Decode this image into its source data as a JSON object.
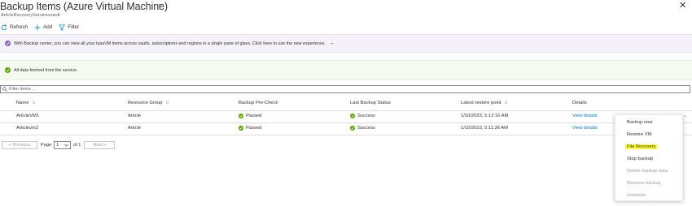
{
  "header": {
    "title": "Backup Items (Azure Virtual Machine)",
    "more": "···",
    "subtitle": "ArticleRecoveryServicesvault",
    "close": "✕"
  },
  "toolbar": {
    "refresh_label": "Refresh",
    "add_label": "Add",
    "filter_label": "Filter"
  },
  "banners": {
    "info_text": "With Backup center, you can view all your IaasVM items across vaults, subscriptions and regions in a single pane of glass. Click here to use the new experience.",
    "info_arrow": "→",
    "success_text": "All data fetched from the service."
  },
  "filter": {
    "placeholder": "Filter items ..."
  },
  "table": {
    "columns": [
      "Name",
      "Resource Group",
      "Backup Pre-Check",
      "Last Backup Status",
      "Latest restore point",
      "Details"
    ],
    "sort_glyph": "↑↓",
    "rows": [
      {
        "name": "ArticleVM1",
        "resource_group": "Article",
        "precheck": "Passed",
        "status": "Success",
        "restore_point": "1/10/2023, 5:12:16 AM",
        "details": "View details"
      },
      {
        "name": "Articlevm2",
        "resource_group": "Article",
        "precheck": "Passed",
        "status": "Success",
        "restore_point": "1/10/2023, 5:11:36 AM",
        "details": "View details"
      }
    ]
  },
  "pager": {
    "prev": "« Previous",
    "page_label": "Page",
    "page_value": "1",
    "of_label": "of 1",
    "next": "Next »"
  },
  "context_menu": {
    "items": [
      {
        "label": "Backup now",
        "enabled": true
      },
      {
        "label": "Restore VM",
        "enabled": true
      },
      {
        "label": "File Recovery",
        "enabled": true,
        "highlighted": true
      },
      {
        "label": "Stop backup",
        "enabled": true
      },
      {
        "label": "Delete backup data",
        "enabled": false
      },
      {
        "label": "Resume backup",
        "enabled": false
      },
      {
        "label": "Undelete",
        "enabled": false
      }
    ]
  },
  "colors": {
    "accent": "#0078d4",
    "success": "#57a300",
    "info_banner_bg": "#f5f1f8",
    "success_banner_bg": "#f4faf0",
    "highlight": "#ffff33"
  }
}
